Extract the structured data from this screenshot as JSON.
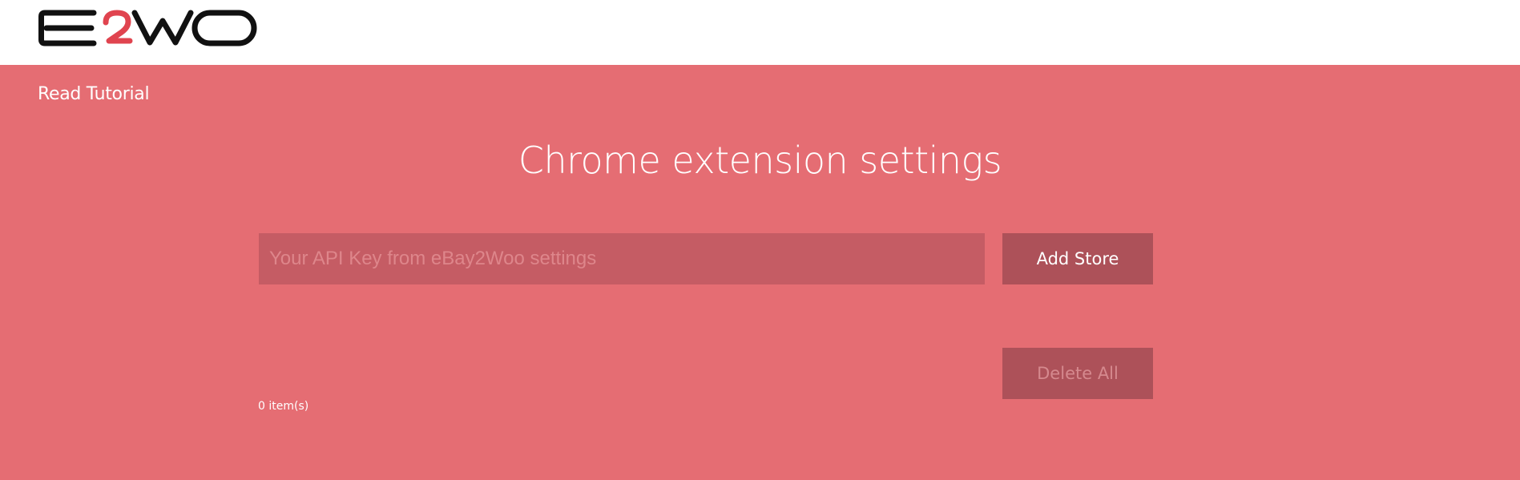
{
  "app": {
    "logo_text": "E2WO"
  },
  "colors": {
    "main_bg": "#e56d73",
    "logo_dark": "#111111",
    "logo_accent": "#e0444f",
    "input_bg": "#c55c64",
    "button_bg": "#ad5159"
  },
  "nav": {
    "tutorial_label": "Read Tutorial"
  },
  "main": {
    "title": "Chrome extension settings",
    "api_input": {
      "value": "",
      "placeholder": "Your API Key from eBay2Woo settings"
    },
    "add_store_label": "Add Store",
    "delete_all_label": "Delete All",
    "item_count": "0 item(s)"
  }
}
